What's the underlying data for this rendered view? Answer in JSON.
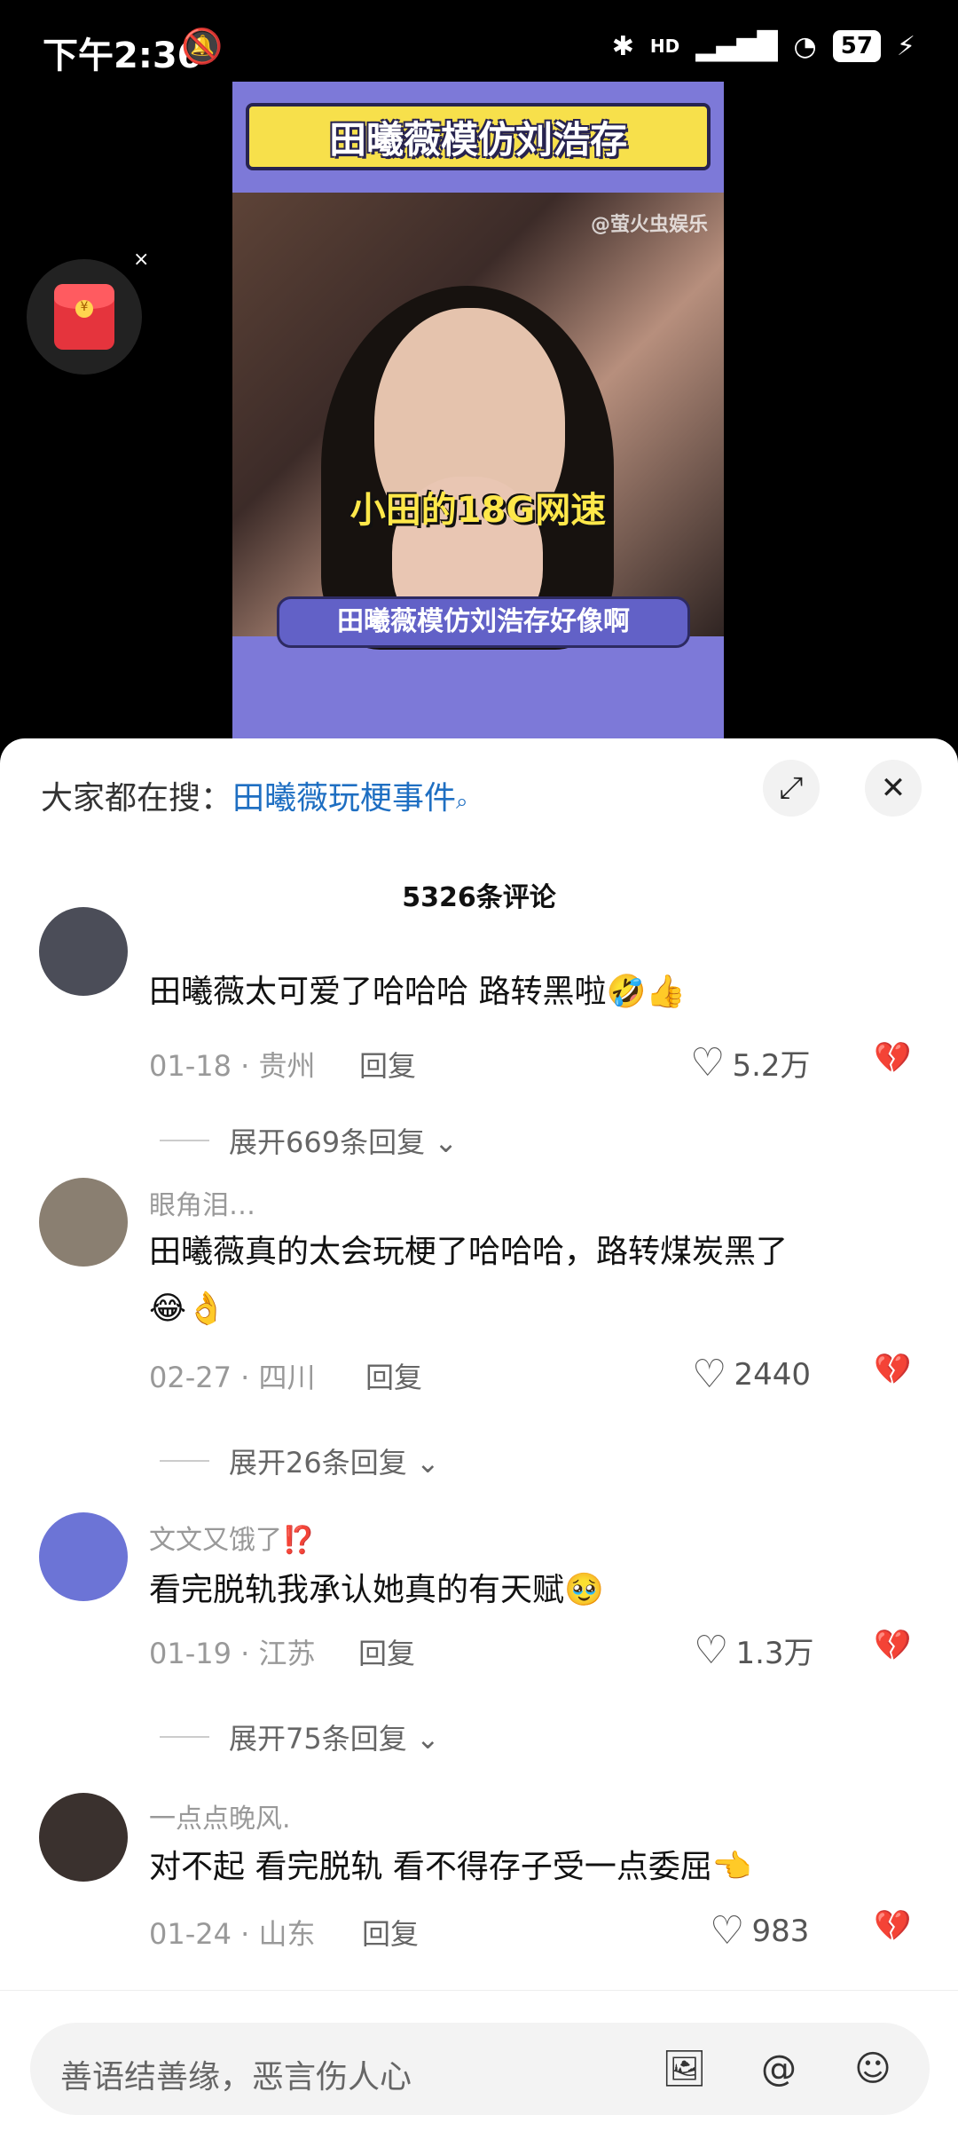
{
  "status_bar": {
    "time": "下午2:36",
    "icons": {
      "mute": "bell-off-icon",
      "bluetooth": "bluetooth-icon",
      "signal": "signal-icon",
      "wifi": "wifi-icon",
      "charging": "charging-icon"
    },
    "network": "HD",
    "battery": "57"
  },
  "video": {
    "banner_title": "田曦薇模仿刘浩存",
    "watermark": "@萤火虫娱乐",
    "caption": "小田的18G网速",
    "subtitle": "田曦薇模仿刘浩存好像啊"
  },
  "red_packet": {
    "icon": "red-packet-icon",
    "close": "×"
  },
  "sheet": {
    "search_prefix": "大家都在搜：",
    "search_term": "田曦薇玩梗事件",
    "expand_icon": "⤢",
    "close_icon": "✕",
    "comment_count": "5326条评论"
  },
  "comments": [
    {
      "username": "",
      "text": "田曦薇太可爱了哈哈哈 路转黑啦",
      "emoji": "🤣👍",
      "date": "01-18",
      "location": "贵州",
      "reply": "回复",
      "likes": "5.2万",
      "expand": "展开669条回复"
    },
    {
      "username": "眼角泪…",
      "text": "田曦薇真的太会玩梗了哈哈哈，路转煤炭黑了",
      "emoji": "😂👌",
      "date": "02-27",
      "location": "四川",
      "reply": "回复",
      "likes": "2440",
      "expand": "展开26条回复"
    },
    {
      "username": "文文又饿了⁉️",
      "text": "看完脱轨我承认她真的有天赋",
      "emoji": "🥹",
      "date": "01-19",
      "location": "江苏",
      "reply": "回复",
      "likes": "1.3万",
      "expand": "展开75条回复"
    },
    {
      "username": "一点点晚风.",
      "text": "对不起 看完脱轨 看不得存子受一点委屈",
      "emoji": "👈",
      "date": "01-24",
      "location": "山东",
      "reply": "回复",
      "likes": "983",
      "expand": ""
    }
  ],
  "input": {
    "placeholder": "善语结善缘，恶言伤人心",
    "icons": {
      "image": "image-icon",
      "mention": "mention-icon",
      "emoji": "emoji-icon"
    }
  }
}
